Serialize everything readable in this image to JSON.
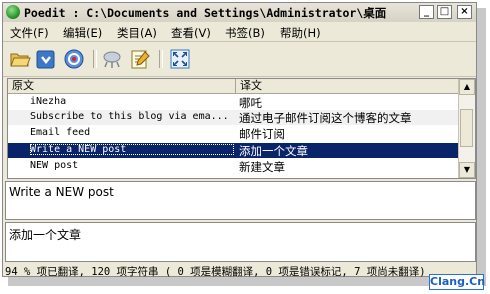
{
  "window": {
    "title": "Poedit : C:\\Documents and Settings\\Administrator\\桌面",
    "min_label": "_",
    "max_label": "□",
    "close_label": "×"
  },
  "menu": [
    {
      "label": "文件(F)"
    },
    {
      "label": "编辑(E)"
    },
    {
      "label": "类目(A)"
    },
    {
      "label": "查看(V)"
    },
    {
      "label": "书签(B)"
    },
    {
      "label": "帮助(H)"
    }
  ],
  "toolbar": {
    "icons": [
      "open-folder-icon",
      "save-icon",
      "update-catalog-icon",
      "validate-icon",
      "edit-comment-icon",
      "fullscreen-icon"
    ]
  },
  "list": {
    "header_source": "原文",
    "header_translation": "译文",
    "rows": [
      {
        "source": "iNezha",
        "translation": "哪吒"
      },
      {
        "source": "Subscribe to this blog via ema...",
        "translation": "通过电子邮件订阅这个博客的文章"
      },
      {
        "source": "Email feed",
        "translation": "邮件订阅"
      },
      {
        "source": "Write a NEW post",
        "translation": "添加一个文章",
        "selected": true
      },
      {
        "source": "NEW post",
        "translation": "新建文章"
      }
    ]
  },
  "source_pane": {
    "text": "Write a NEW post"
  },
  "translation_pane": {
    "text": "添加一个文章"
  },
  "statusbar": {
    "text": "94 % 项已翻译, 120 项字符串 ( 0 项是模糊翻译, 0 项是错误标记, 7 项尚未翻译)"
  },
  "watermark": {
    "text": "Clang.Cn"
  },
  "colors": {
    "selection": "#0a246a",
    "window_bg": "#ece9d8",
    "watermark": "#1b5fc4"
  }
}
